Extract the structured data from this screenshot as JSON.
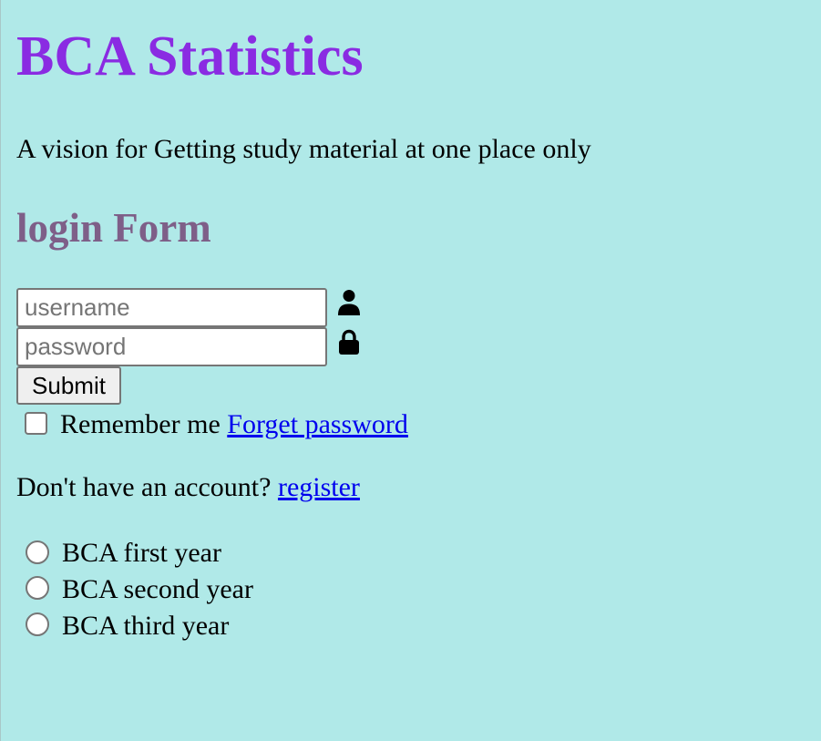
{
  "header": {
    "title": "BCA Statistics",
    "tagline": "A vision for Getting study material at one place only"
  },
  "login_form": {
    "title": "login Form",
    "username": {
      "placeholder": "username",
      "value": "",
      "icon": "user-icon"
    },
    "password": {
      "placeholder": "password",
      "value": "",
      "icon": "lock-icon"
    },
    "submit_label": "Submit",
    "remember_me": {
      "label": "Remember me",
      "checked": false
    },
    "forgot_link": "Forget password"
  },
  "register": {
    "prompt": "Don't have an account?",
    "link": "register"
  },
  "year_options": [
    {
      "label": "BCA first year",
      "selected": false
    },
    {
      "label": "BCA second year",
      "selected": false
    },
    {
      "label": "BCA third year",
      "selected": false
    }
  ],
  "colors": {
    "background": "#b0e9e8",
    "title": "#8a2be2",
    "form_title": "#7e5f88",
    "link": "#0000ee"
  }
}
